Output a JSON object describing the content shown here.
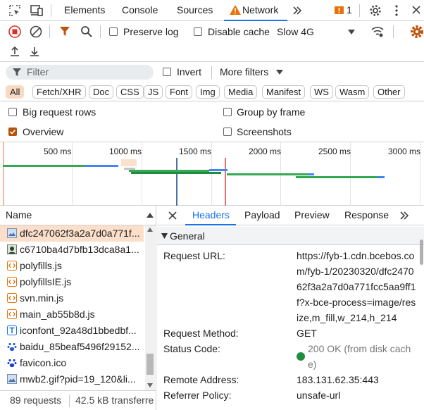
{
  "tabs": {
    "elements": "Elements",
    "console": "Console",
    "sources": "Sources",
    "network": "Network",
    "issues_count": "1"
  },
  "toolbar": {
    "preserve_log": "Preserve log",
    "disable_cache": "Disable cache",
    "throttle": "Slow 4G"
  },
  "filter": {
    "placeholder": "Filter",
    "invert": "Invert",
    "more_filters": "More filters"
  },
  "type_filters": [
    "All",
    "Fetch/XHR",
    "Doc",
    "CSS",
    "JS",
    "Font",
    "Img",
    "Media",
    "Manifest",
    "WS",
    "Wasm",
    "Other"
  ],
  "options": {
    "big_request_rows": "Big request rows",
    "group_by_frame": "Group by frame",
    "overview": "Overview",
    "screenshots": "Screenshots"
  },
  "overview": {
    "ticks": [
      "500 ms",
      "1000 ms",
      "1500 ms",
      "2000 ms",
      "2500 ms",
      "3000 ms"
    ]
  },
  "requests": {
    "header": "Name",
    "items": [
      "dfc247062f3a2a7d0a771f...",
      "c6710ba4d7bfb13dca8a1...",
      "polyfills.js",
      "polyfillsIE.js",
      "svn.min.js",
      "main_ab55b8d.js",
      "iconfont_92a48d1bbedbf...",
      "baidu_85beaf5496f29152...",
      "favicon.ico",
      "mwb2.gif?pid=19_120&li..."
    ],
    "count": "89 requests",
    "transferred": "42.5 kB transferre"
  },
  "detail": {
    "tabs": [
      "Headers",
      "Payload",
      "Preview",
      "Response"
    ],
    "section": "General",
    "fields": [
      {
        "key": "Request URL:",
        "value": "https://fyb-1.cdn.bcebos.com/fyb-1/20230320/dfc247062f3a2a7d0a771fcc5aa9ff1f?x-bce-process=image/resize,m_fill,w_214,h_214"
      },
      {
        "key": "Request Method:",
        "value": "GET"
      },
      {
        "key": "Status Code:",
        "value": "200 OK (from disk cache)"
      },
      {
        "key": "Remote Address:",
        "value": "183.131.62.35:443"
      },
      {
        "key": "Referrer Policy:",
        "value": "unsafe-url"
      }
    ]
  },
  "colors": {
    "accent": "#1a73e8",
    "selected_row": "#fbdfcb",
    "status_ok": "#1e8e3e",
    "warning": "#e8710a"
  }
}
